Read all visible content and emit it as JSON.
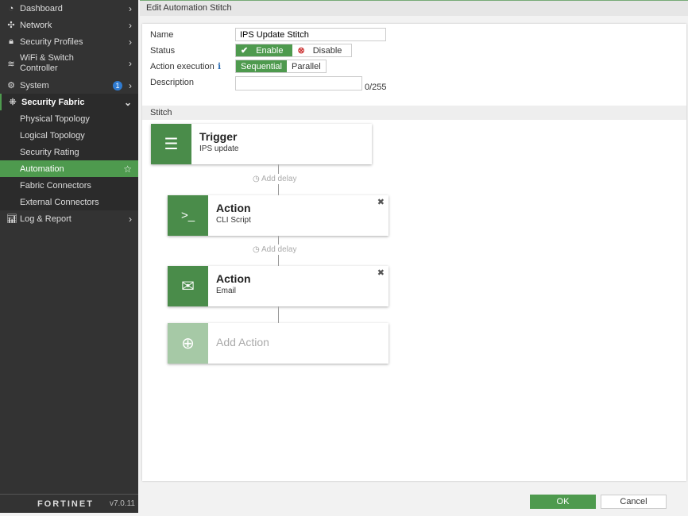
{
  "sidebar": {
    "items": [
      {
        "label": "Dashboard",
        "icon": "dashboard-icon"
      },
      {
        "label": "Network",
        "icon": "network-icon"
      },
      {
        "label": "Security Profiles",
        "icon": "lock-icon"
      },
      {
        "label": "WiFi & Switch Controller",
        "icon": "wifi-icon"
      },
      {
        "label": "System",
        "icon": "gear-icon",
        "badge": "1"
      },
      {
        "label": "Security Fabric",
        "icon": "fabric-icon"
      },
      {
        "label": "Log & Report",
        "icon": "chart-icon"
      }
    ],
    "sub": [
      "Physical Topology",
      "Logical Topology",
      "Security Rating",
      "Automation",
      "Fabric Connectors",
      "External Connectors"
    ],
    "logo": "FORTINET",
    "version": "v7.0.11"
  },
  "header": {
    "title": "Edit Automation Stitch"
  },
  "form": {
    "name_label": "Name",
    "name_value": "IPS Update Stitch",
    "status_label": "Status",
    "enable": "Enable",
    "disable": "Disable",
    "exec_label": "Action execution",
    "sequential": "Sequential",
    "parallel": "Parallel",
    "desc_label": "Description",
    "counter": "0/255"
  },
  "stitch": {
    "title": "Stitch",
    "trigger_title": "Trigger",
    "trigger_sub": "IPS update",
    "action_title": "Action",
    "action1_sub": "CLI Script",
    "action2_sub": "Email",
    "add_delay": "Add delay",
    "add_action": "Add Action"
  },
  "buttons": {
    "ok": "OK",
    "cancel": "Cancel"
  },
  "colors": {
    "accent": "#4a8c4a"
  }
}
